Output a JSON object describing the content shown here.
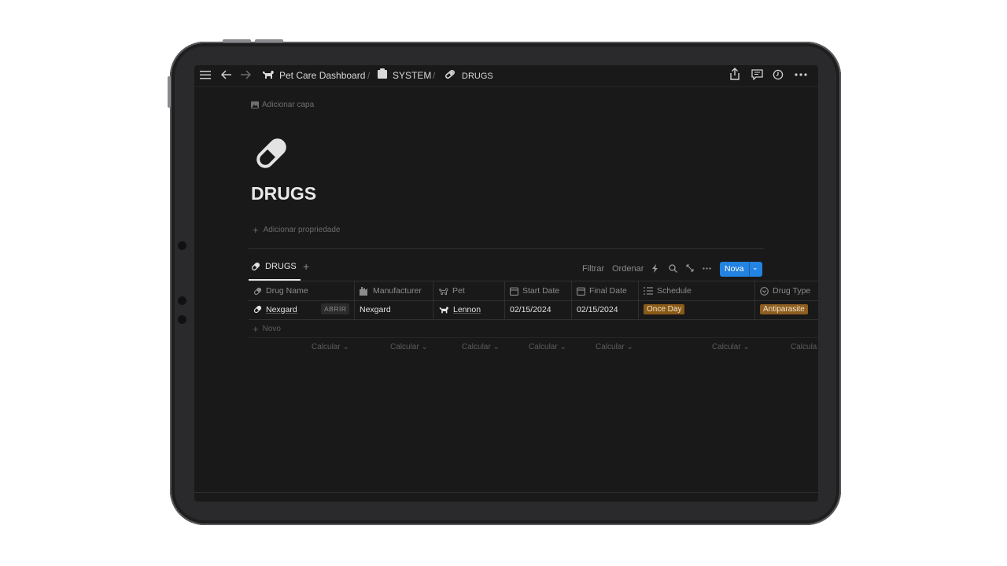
{
  "breadcrumb": {
    "items": [
      {
        "label": "Pet Care Dashboard",
        "icon": "dog-icon"
      },
      {
        "label": "SYSTEM",
        "icon": "clipboard-icon"
      },
      {
        "label": "DRUGS",
        "icon": "pill-icon"
      }
    ],
    "separator": "/"
  },
  "page": {
    "add_cover": "Adicionar capa",
    "title": "DRUGS",
    "add_property": "Adicionar propriedade"
  },
  "view": {
    "tab_label": "DRUGS",
    "toolbar": {
      "filter": "Filtrar",
      "sort": "Ordenar",
      "new_button": "Nova"
    }
  },
  "table": {
    "columns": [
      {
        "label": "Drug Name",
        "icon": "pill-icon"
      },
      {
        "label": "Manufacturer",
        "icon": "factory-icon"
      },
      {
        "label": "Pet",
        "icon": "dog-icon"
      },
      {
        "label": "Start Date",
        "icon": "calendar-icon"
      },
      {
        "label": "Final Date",
        "icon": "calendar-icon"
      },
      {
        "label": "Schedule",
        "icon": "list-icon"
      },
      {
        "label": "Drug Type",
        "icon": "select-icon"
      }
    ],
    "rows": [
      {
        "drug_name": "Nexgard",
        "open_label": "ABRIR",
        "manufacturer": "Nexgard",
        "pet": "Lennon",
        "start_date": "02/15/2024",
        "final_date": "02/15/2024",
        "schedule": "Once Day",
        "drug_type": "Antiparasite"
      }
    ],
    "new_row_label": "Novo",
    "calc_label": "Calcular",
    "calc_label_cut": "Calcula"
  },
  "colors": {
    "accent": "#2383e2",
    "tag_brown": "#8a5a19",
    "background": "#191919"
  }
}
